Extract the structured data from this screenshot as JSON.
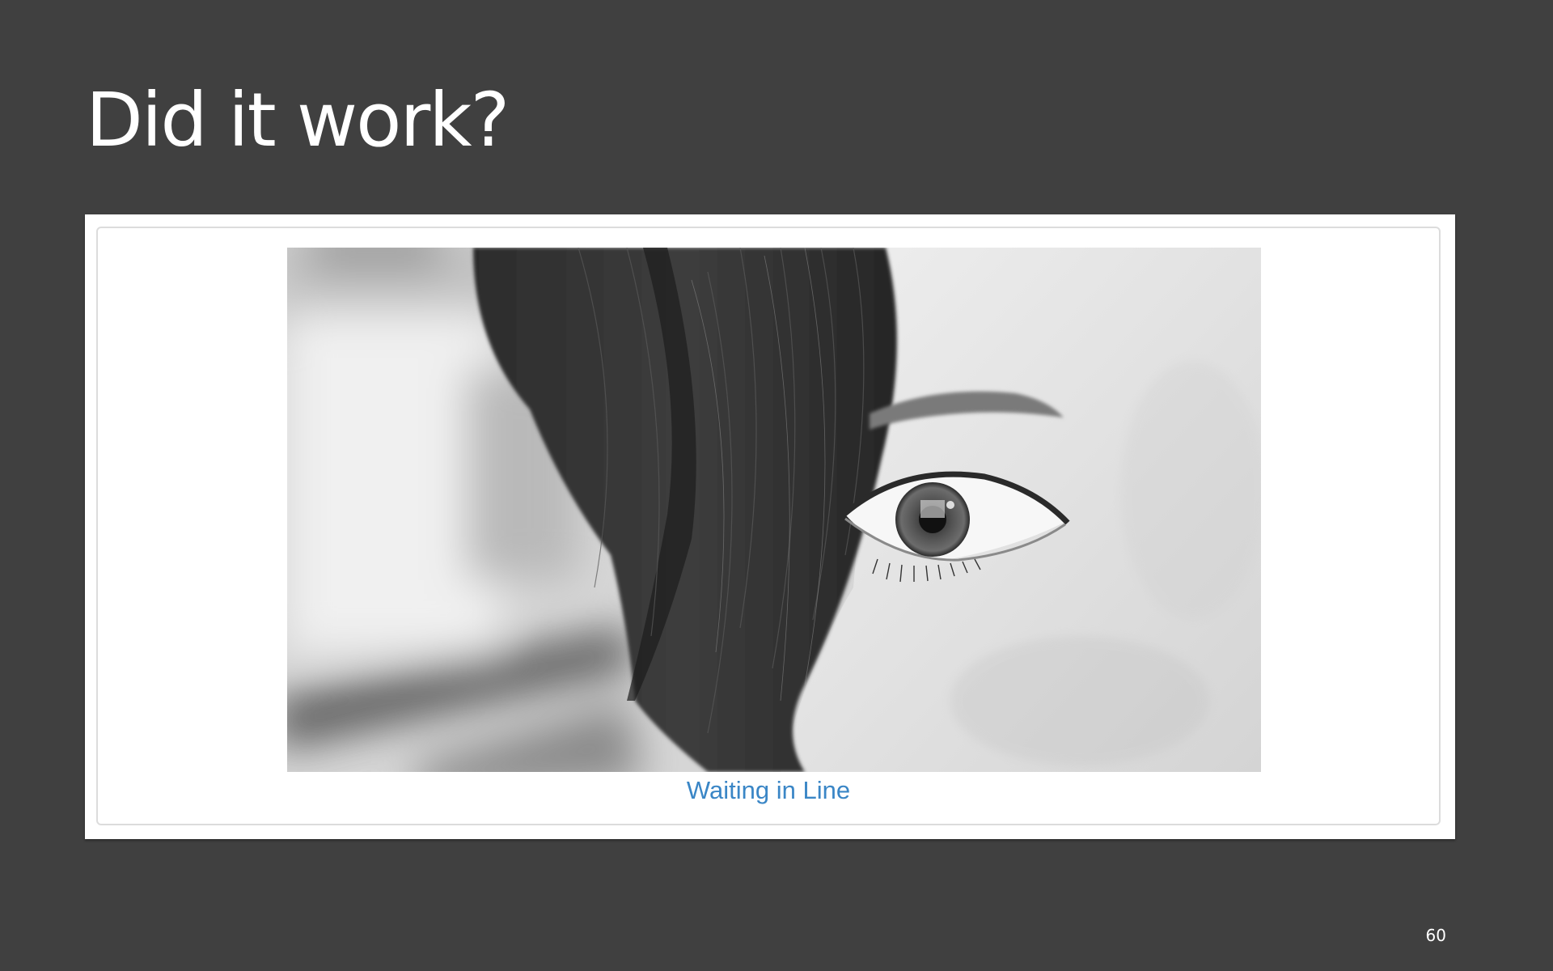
{
  "slide": {
    "title": "Did it work?",
    "page_number": "60"
  },
  "gallery": {
    "caption": "Waiting in Line",
    "image_alt": "black and white close-up of a woman's eye with hair falling across the face"
  },
  "colors": {
    "slide_background": "#404040",
    "caption_link": "#3a86c6",
    "card_border": "#dcdcdc"
  }
}
